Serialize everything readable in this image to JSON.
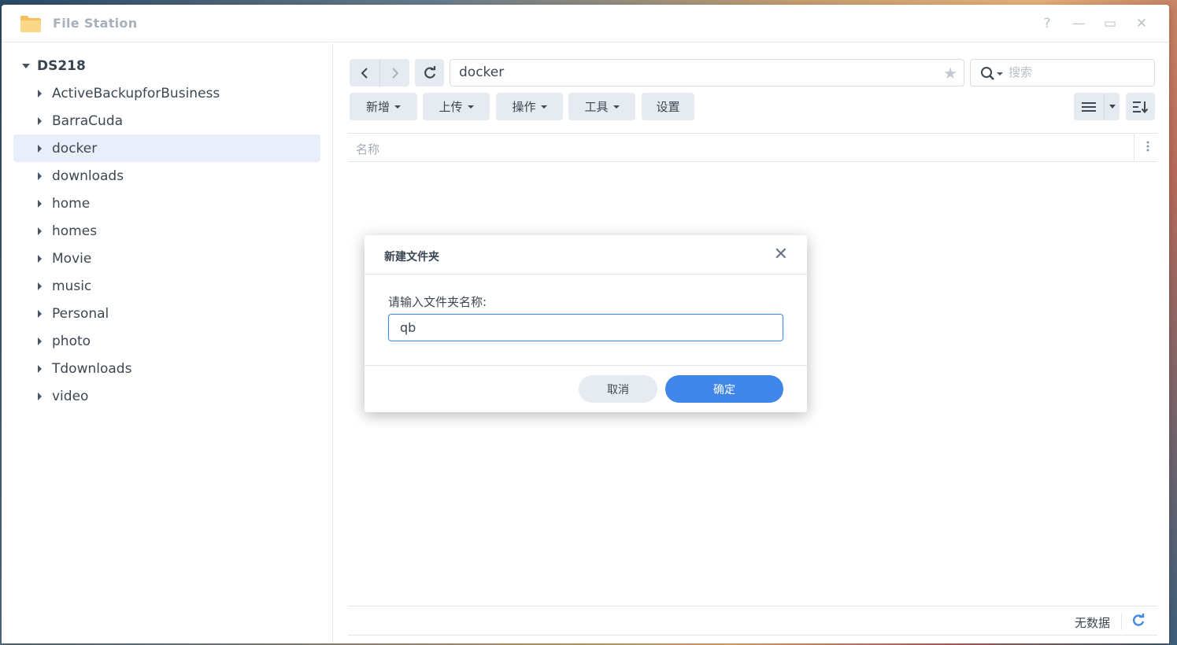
{
  "window": {
    "title": "File Station",
    "buttons": {
      "help": "?",
      "minimize": "—",
      "maximize": "▭",
      "close": "✕"
    }
  },
  "sidebar": {
    "root": "DS218",
    "items": [
      {
        "label": "ActiveBackupforBusiness"
      },
      {
        "label": "BarraCuda"
      },
      {
        "label": "docker",
        "selected": true
      },
      {
        "label": "downloads"
      },
      {
        "label": "home"
      },
      {
        "label": "homes"
      },
      {
        "label": "Movie"
      },
      {
        "label": "music"
      },
      {
        "label": "Personal"
      },
      {
        "label": "photo"
      },
      {
        "label": "Tdownloads"
      },
      {
        "label": "video"
      }
    ]
  },
  "toolbar": {
    "path": "docker",
    "search_placeholder": "搜索",
    "buttons": {
      "create": "新增",
      "upload": "上传",
      "action": "操作",
      "tools": "工具",
      "settings": "设置"
    }
  },
  "file_list": {
    "column_name": "名称",
    "empty_text": "无数据"
  },
  "dialog": {
    "title": "新建文件夹",
    "close": "✕",
    "prompt": "请输入文件夹名称:",
    "input_value": "qb",
    "cancel": "取消",
    "ok": "确定"
  },
  "colors": {
    "accent": "#3f87e8",
    "selected_row": "#e8effa",
    "button_bg": "#e5ebf1"
  }
}
